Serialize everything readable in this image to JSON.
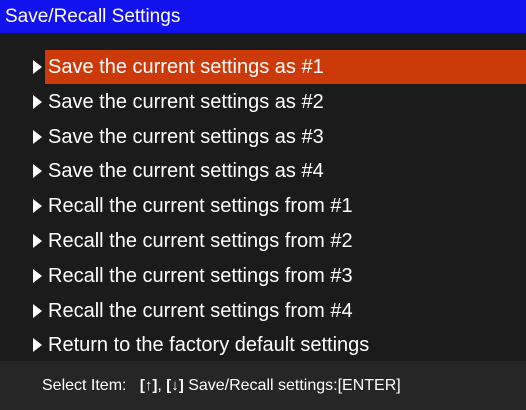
{
  "title": "Save/Recall Settings",
  "menu": {
    "items": [
      {
        "label": "Save the current settings as #1",
        "selected": true
      },
      {
        "label": "Save the current settings as #2",
        "selected": false
      },
      {
        "label": "Save the current settings as #3",
        "selected": false
      },
      {
        "label": "Save the current settings as #4",
        "selected": false
      },
      {
        "label": "Recall the current settings from #1",
        "selected": false
      },
      {
        "label": "Recall the current settings from #2",
        "selected": false
      },
      {
        "label": "Recall the current settings from #3",
        "selected": false
      },
      {
        "label": "Recall the current settings from #4",
        "selected": false
      },
      {
        "label": "Return to the factory default settings",
        "selected": false
      }
    ],
    "item_icon": "triangle-right-icon"
  },
  "footer": {
    "select_label": "Select Item:",
    "up_key": "[↑]",
    "separator": ",",
    "down_key": "[↓]",
    "action_text": "Save/Recall settings:[ENTER]"
  },
  "colors": {
    "title_bar": "#1212ee",
    "background": "#1b1b1b",
    "selected_highlight": "#cc3a0a",
    "footer_background": "#262626",
    "text": "#ffffff"
  }
}
